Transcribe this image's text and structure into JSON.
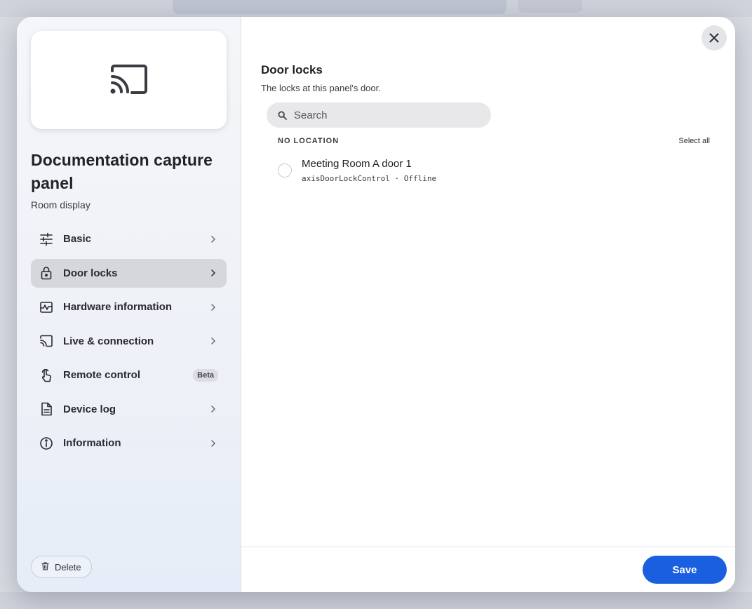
{
  "device": {
    "title": "Documentation capture panel",
    "subtitle": "Room display",
    "preview_icon": "cast-icon"
  },
  "sidebar": {
    "items": [
      {
        "label": "Basic",
        "icon": "sliders-icon",
        "active": false
      },
      {
        "label": "Door locks",
        "icon": "lock-icon",
        "active": true
      },
      {
        "label": "Hardware information",
        "icon": "monitor-chart-icon",
        "active": false
      },
      {
        "label": "Live & connection",
        "icon": "cast-icon",
        "active": false
      },
      {
        "label": "Remote control",
        "icon": "touch-icon",
        "active": false,
        "badge": "Beta"
      },
      {
        "label": "Device log",
        "icon": "document-icon",
        "active": false
      },
      {
        "label": "Information",
        "icon": "info-icon",
        "active": false
      }
    ],
    "delete_label": "Delete"
  },
  "main": {
    "section_title": "Door locks",
    "section_desc": "The locks at this panel's door.",
    "search_placeholder": "Search",
    "group": {
      "label": "NO LOCATION",
      "select_all": "Select all",
      "locks": [
        {
          "name": "Meeting Room A door 1",
          "type": "axisDoorLockControl",
          "status": "Offline",
          "selected": false
        }
      ]
    },
    "save_label": "Save"
  },
  "colors": {
    "accent": "#1a5fe0",
    "active_nav": "#d5d7dd"
  }
}
